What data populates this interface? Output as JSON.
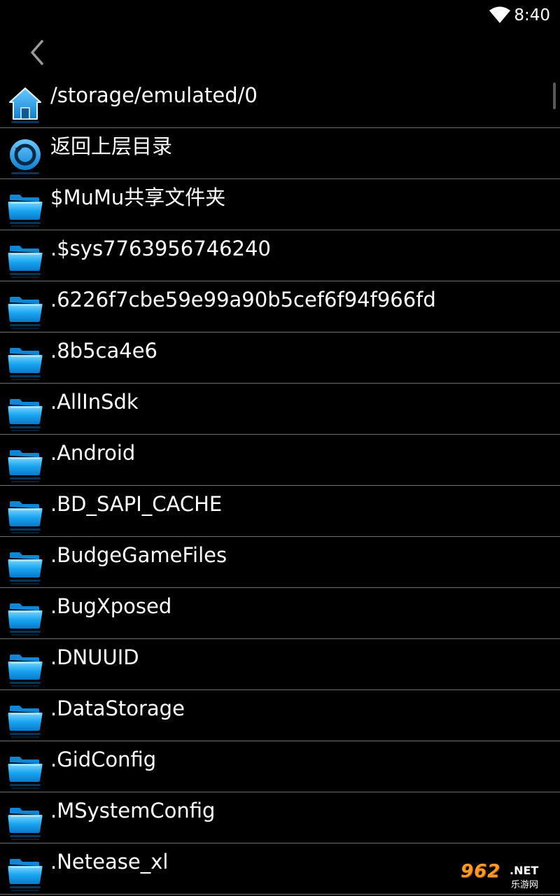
{
  "status_bar": {
    "time": "8:40",
    "wifi_icon": "wifi-icon"
  },
  "toolbar": {
    "back_icon": "chevron-left-icon"
  },
  "file_list": {
    "items": [
      {
        "label": "/storage/emulated/0",
        "icon": "home-icon"
      },
      {
        "label": "返回上层目录",
        "icon": "back-circle-icon"
      },
      {
        "label": "$MuMu共享文件夹",
        "icon": "folder-icon"
      },
      {
        "label": ".$sys7763956746240",
        "icon": "folder-icon"
      },
      {
        "label": ".6226f7cbe59e99a90b5cef6f94f966fd",
        "icon": "folder-icon"
      },
      {
        "label": ".8b5ca4e6",
        "icon": "folder-icon"
      },
      {
        "label": ".AllInSdk",
        "icon": "folder-icon"
      },
      {
        "label": ".Android",
        "icon": "folder-icon"
      },
      {
        "label": ".BD_SAPI_CACHE",
        "icon": "folder-icon"
      },
      {
        "label": ".BudgeGameFiles",
        "icon": "folder-icon"
      },
      {
        "label": ".BugXposed",
        "icon": "folder-icon"
      },
      {
        "label": ".DNUUID",
        "icon": "folder-icon"
      },
      {
        "label": ".DataStorage",
        "icon": "folder-icon"
      },
      {
        "label": ".GidConfig",
        "icon": "folder-icon"
      },
      {
        "label": ".MSystemConfig",
        "icon": "folder-icon"
      },
      {
        "label": ".Netease_xl",
        "icon": "folder-icon"
      }
    ]
  },
  "watermark": {
    "main": "962",
    "net": ".NET",
    "sub": "乐游网"
  },
  "colors": {
    "background": "#000000",
    "divider": "#6e6e6e",
    "icon_blue": "#1aa3f0",
    "watermark_orange": "#ff9a1f"
  }
}
